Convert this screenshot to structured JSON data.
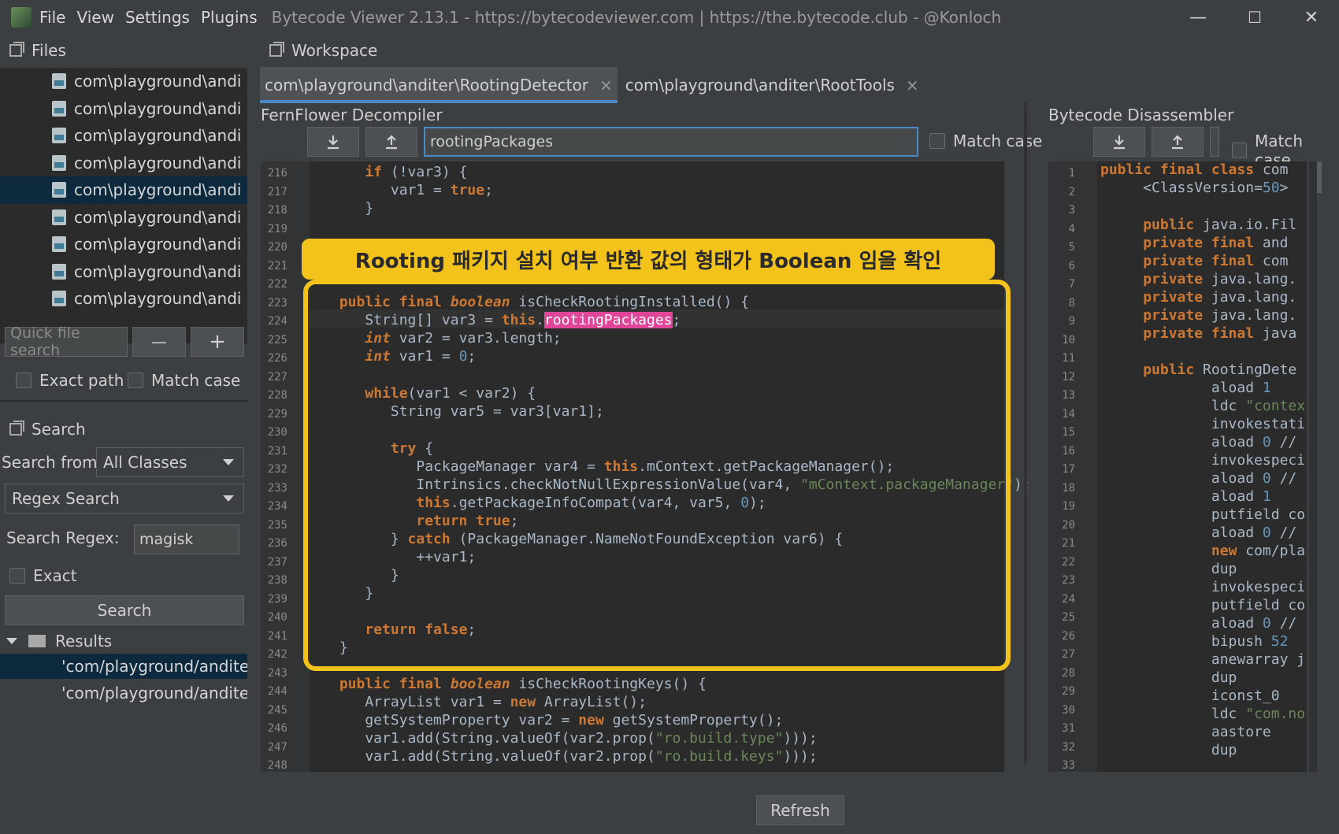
{
  "window": {
    "menus": [
      "File",
      "View",
      "Settings",
      "Plugins"
    ],
    "title": "Bytecode Viewer 2.13.1 - https://bytecodeviewer.com | https://the.bytecode.club - @Konloch",
    "controls": {
      "minimize": "—",
      "maximize": "☐",
      "close": "✕"
    }
  },
  "files_panel": {
    "title": "Files",
    "items": [
      "com\\playground\\andi",
      "com\\playground\\andi",
      "com\\playground\\andi",
      "com\\playground\\andi",
      "com\\playground\\andi",
      "com\\playground\\andi",
      "com\\playground\\andi",
      "com\\playground\\andi",
      "com\\playground\\andi"
    ],
    "selected_index": 4,
    "quick_search_placeholder": "Quick file search",
    "minus_label": "—",
    "plus_label": "+",
    "exact_path_label": "Exact path",
    "match_case_label": "Match case"
  },
  "search_panel": {
    "title": "Search",
    "search_from_label": "Search from",
    "search_from_value": "All Classes",
    "search_type_value": "Regex Search",
    "regex_label": "Search Regex:",
    "regex_value": "magisk",
    "exact_label": "Exact",
    "search_button": "Search",
    "results_label": "Results",
    "results": [
      "'com/playground/andite",
      "'com/playground/andite"
    ]
  },
  "workspace": {
    "title": "Workspace",
    "tabs": [
      {
        "label": "com\\playground\\anditer\\RootingDetector",
        "close": "×"
      },
      {
        "label": "com\\playground\\anditer\\RootTools",
        "close": "×"
      }
    ],
    "refresh_label": "Refresh"
  },
  "decompiler": {
    "title": "FernFlower Decompiler",
    "search_value": "rootingPackages",
    "match_case_label": "Match case",
    "line_numbers": [
      "216",
      "217",
      "218",
      "219",
      "220",
      "221",
      "222",
      "223",
      "224",
      "225",
      "226",
      "227",
      "228",
      "229",
      "230",
      "231",
      "232",
      "233",
      "234",
      "235",
      "236",
      "237",
      "238",
      "239",
      "240",
      "241",
      "242",
      "243",
      "244",
      "245",
      "246",
      "247",
      "248"
    ]
  },
  "disassembler": {
    "title": "Bytecode Disassembler",
    "match_case_label": "Match case",
    "line_numbers": [
      "1",
      "2",
      "3",
      "4",
      "5",
      "6",
      "7",
      "8",
      "9",
      "10",
      "11",
      "12",
      "13",
      "14",
      "15",
      "16",
      "17",
      "18",
      "19",
      "20",
      "21",
      "22",
      "23",
      "24",
      "25",
      "26",
      "27",
      "28",
      "29",
      "30",
      "31",
      "32",
      "33"
    ]
  },
  "annotation": {
    "text": "Rooting 패키지 설치 여부 반환 값의 형태가 Boolean 임을 확인",
    "color": "#f3c21b"
  }
}
